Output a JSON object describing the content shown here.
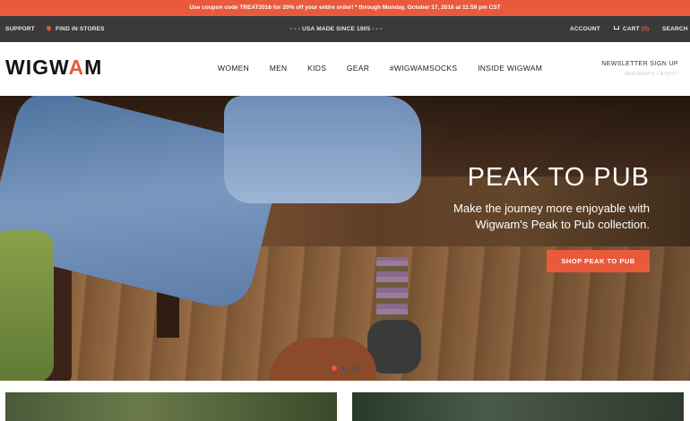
{
  "promo": {
    "text": "Use coupon code TREAT2016 for 20% off your entire order! * through Monday, October 17, 2016 at 11:59 pm CST"
  },
  "utility": {
    "support": "SUPPORT",
    "find_stores": "FIND IN STORES",
    "made_in": "- - - USA MADE SINCE 1905 - - -",
    "account": "ACCOUNT",
    "cart_label": "CART",
    "cart_count": "(0)",
    "search": "SEARCH"
  },
  "brand": {
    "logo_left": "WIGW",
    "logo_a": "A",
    "logo_right": "M",
    "accent": "#e95a3c"
  },
  "nav": {
    "items": [
      "WOMEN",
      "MEN",
      "KIDS",
      "GEAR",
      "#WIGWAMSOCKS",
      "INSIDE WIGWAM"
    ]
  },
  "newsletter": {
    "title": "NEWSLETTER SIGN UP",
    "subtitle": "WIGWAM'S LATEST"
  },
  "hero": {
    "title": "PEAK TO PUB",
    "subtitle_line1": "Make the journey more enjoyable with",
    "subtitle_line2": "Wigwam's Peak to Pub collection.",
    "cta": "SHOP PEAK TO PUB",
    "slides": {
      "count": 3,
      "active_index": 0
    }
  }
}
